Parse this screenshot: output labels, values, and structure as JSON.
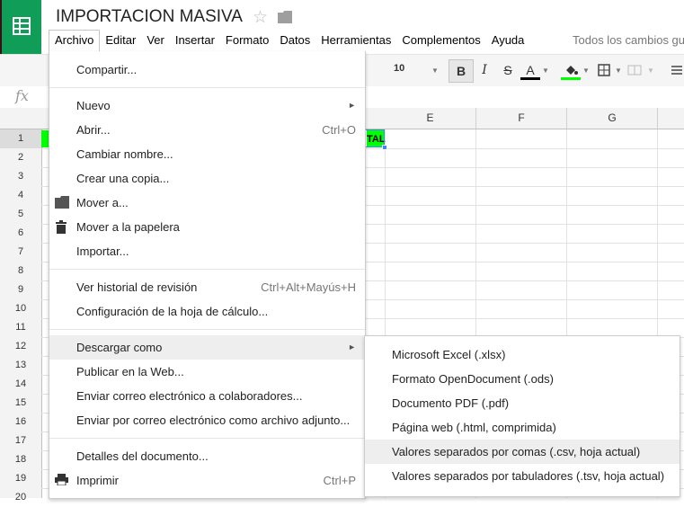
{
  "doc": {
    "title": "IMPORTACION MASIVA",
    "saved_status": "Todos los cambios gu"
  },
  "menubar": [
    "Archivo",
    "Editar",
    "Ver",
    "Insertar",
    "Formato",
    "Datos",
    "Herramientas",
    "Complementos",
    "Ayuda"
  ],
  "toolbar": {
    "font_size": "10",
    "bold": "B",
    "italic": "I",
    "strike": "S",
    "text_color": "A",
    "text_color_hex": "#000000",
    "fill_color_hex": "#00ff00"
  },
  "formula": {
    "fx": "fx"
  },
  "columns": [
    "E",
    "F",
    "G"
  ],
  "rows": [
    "1",
    "2",
    "3",
    "4",
    "5",
    "6",
    "7",
    "8",
    "9",
    "10",
    "11",
    "12",
    "13",
    "14",
    "15",
    "16",
    "17",
    "18",
    "19",
    "20"
  ],
  "cells": {
    "d1_fragment": "TAL"
  },
  "file_menu": {
    "items": [
      {
        "label": "Compartir..."
      },
      {
        "label": "Nuevo",
        "arrow": "►"
      },
      {
        "label": "Abrir...",
        "shortcut": "Ctrl+O"
      },
      {
        "label": "Cambiar nombre..."
      },
      {
        "label": "Crear una copia..."
      },
      {
        "label": "Mover a...",
        "icon": "folder-icon"
      },
      {
        "label": "Mover a la papelera",
        "icon": "trash-icon"
      },
      {
        "label": "Importar..."
      },
      {
        "label": "Ver historial de revisión",
        "shortcut": "Ctrl+Alt+Mayús+H"
      },
      {
        "label": "Configuración de la hoja de cálculo..."
      },
      {
        "label": "Descargar como",
        "arrow": "►"
      },
      {
        "label": "Publicar en la Web..."
      },
      {
        "label": "Enviar correo electrónico a colaboradores..."
      },
      {
        "label": "Enviar por correo electrónico como archivo adjunto..."
      },
      {
        "label": "Detalles del documento..."
      },
      {
        "label": "Imprimir",
        "shortcut": "Ctrl+P",
        "icon": "printer-icon"
      }
    ]
  },
  "download_submenu": {
    "items": [
      {
        "label": "Microsoft Excel (.xlsx)"
      },
      {
        "label": "Formato OpenDocument (.ods)"
      },
      {
        "label": "Documento PDF (.pdf)"
      },
      {
        "label": "Página web (.html, comprimida)"
      },
      {
        "label": "Valores separados por comas (.csv, hoja actual)"
      },
      {
        "label": "Valores separados por tabuladores (.tsv, hoja actual)"
      }
    ]
  },
  "colors": {
    "brand_green": "#0f9d58",
    "highlight": "#eeeeee",
    "selection_blue": "#4285f4"
  }
}
